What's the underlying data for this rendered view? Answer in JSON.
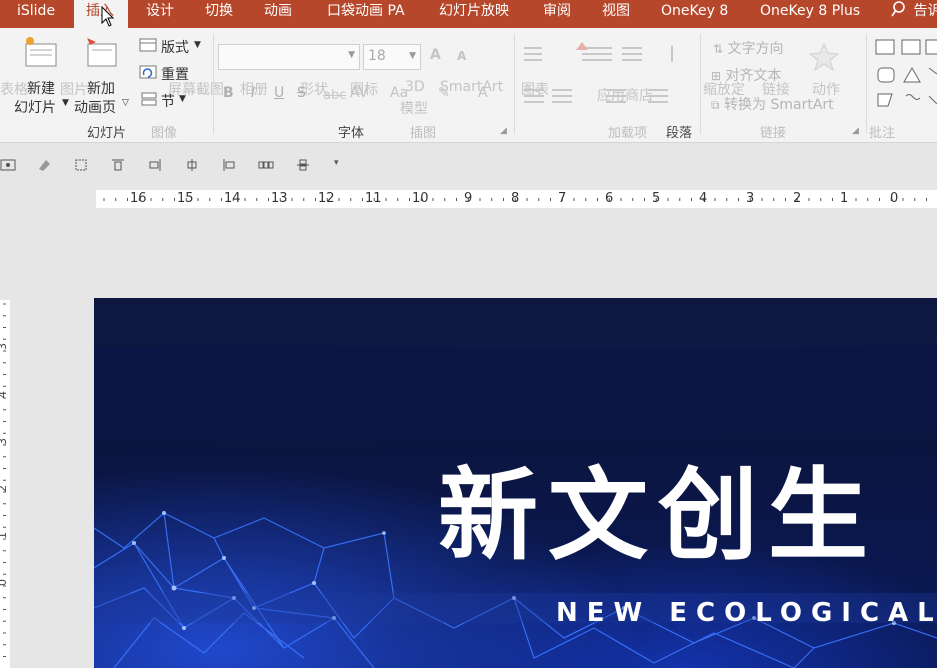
{
  "tabs": [
    {
      "label": "iSlide",
      "active": false
    },
    {
      "label": "插入",
      "active": true
    },
    {
      "label": "设计",
      "active": false
    },
    {
      "label": "切换",
      "active": false
    },
    {
      "label": "动画",
      "active": false
    },
    {
      "label": "口袋动画 PA",
      "active": false
    },
    {
      "label": "幻灯片放映",
      "active": false
    },
    {
      "label": "审阅",
      "active": false
    },
    {
      "label": "视图",
      "active": false
    },
    {
      "label": "OneKey 8",
      "active": false
    },
    {
      "label": "OneKey 8 Plus",
      "active": false
    }
  ],
  "search_label": "告诉",
  "ribbon": {
    "new_slide_line1": "新建",
    "new_slide_line2": "幻灯片",
    "new_anim_line1": "新加",
    "new_anim_line2": "动画页",
    "layout": "版式",
    "reset": "重置",
    "section": "节",
    "font_size": "18",
    "group_slides": "幻灯片",
    "group_font": "字体",
    "group_image_dim": "图像",
    "group_illustration_dim": "插图",
    "group_addins_dim": "加载项",
    "group_paragraph": "段落",
    "group_links_dim": "链接",
    "group_comments_dim": "批注",
    "text_direction": "文字方向",
    "align_text": "对齐文本",
    "convert_smartart": "转换为 SmartArt",
    "ghost_table": "表格",
    "ghost_picture": "图片",
    "ghost_screenshot": "屏幕截图",
    "ghost_album": "相册",
    "ghost_shapes": "形状",
    "ghost_icons": "图标",
    "ghost_3d": "3D",
    "ghost_model": "模型",
    "ghost_smartart": "SmartArt",
    "ghost_chart": "图表",
    "ghost_action": "动作",
    "ghost_link": "链接",
    "ghost_zoom": "缩放定",
    "ghost_store": "应用商店",
    "ghost_comment": "批注"
  },
  "ruler_h": [
    "16",
    "15",
    "14",
    "13",
    "12",
    "11",
    "10",
    "9",
    "8",
    "7",
    "6",
    "5",
    "4",
    "3",
    "2",
    "1",
    "0"
  ],
  "ruler_v": [
    "3",
    "4",
    "3",
    "2",
    "1",
    "0"
  ],
  "slide": {
    "title": "新文创生",
    "subtitle": "NEW ECOLOGICAL"
  },
  "colors": {
    "accent": "#b7472a",
    "slide_bg": "#0c1541",
    "network": "#2f6bff"
  }
}
